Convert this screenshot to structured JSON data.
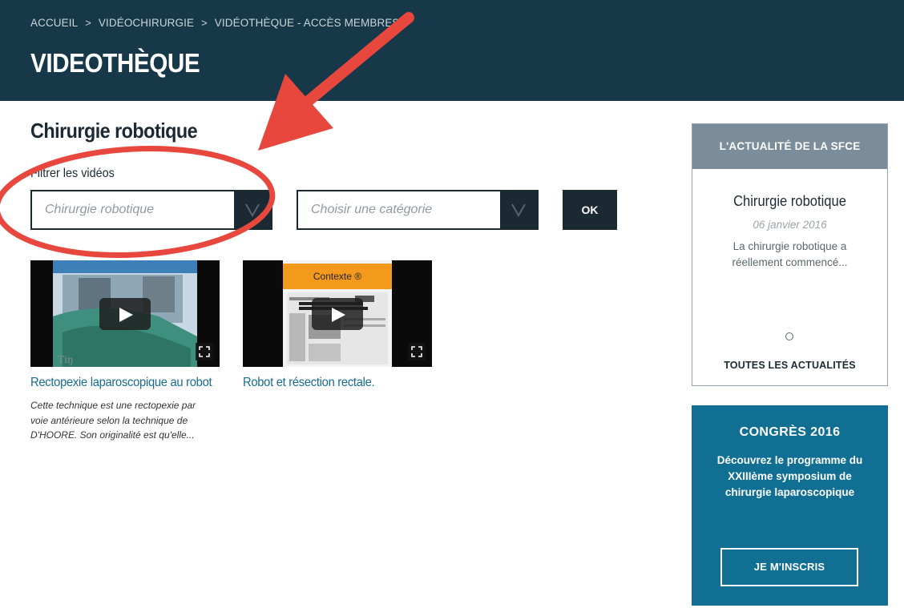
{
  "header": {
    "breadcrumb": [
      "ACCUEIL",
      "VIDÉOCHIRURGIE",
      "VIDÉOTHÈQUE - ACCÈS MEMBRES"
    ],
    "separator": ">",
    "title": "VIDEOTHÈQUE"
  },
  "main": {
    "section_title": "Chirurgie robotique",
    "filter_label": "Filtrer les vidéos",
    "filters": [
      {
        "value": "Chirurgie robotique"
      },
      {
        "value": "Choisir une catégorie"
      }
    ],
    "ok_label": "OK",
    "videos": [
      {
        "title": "Rectopexie laparoscopique au robot",
        "description": "Cette technique est une rectopexie par voie antérieure selon la technique de D'HOORE. Son originalité est qu'elle..."
      },
      {
        "title": "Robot et résection rectale.",
        "description": "",
        "slide_heading": "Contexte ®"
      }
    ]
  },
  "sidebar": {
    "news": {
      "header": "L'ACTUALITÉ DE LA SFCE",
      "title": "Chirurgie robotique",
      "date": "06 janvier 2016",
      "excerpt": "La chirurgie robotique a réellement commencé...",
      "all_label": "TOUTES LES ACTUALITÉS"
    },
    "congress": {
      "title": "CONGRÈS 2016",
      "text": "Découvrez le programme du XXIIIème symposium de chirurgie laparoscopique",
      "button_label": "JE M'INSCRIS"
    }
  },
  "colors": {
    "header_bg": "#163848",
    "dark": "#1b2a32",
    "link": "#166b91",
    "news_header": "#7b8d9a",
    "congress_bg": "#126f94",
    "annotation": "#e8473d"
  }
}
